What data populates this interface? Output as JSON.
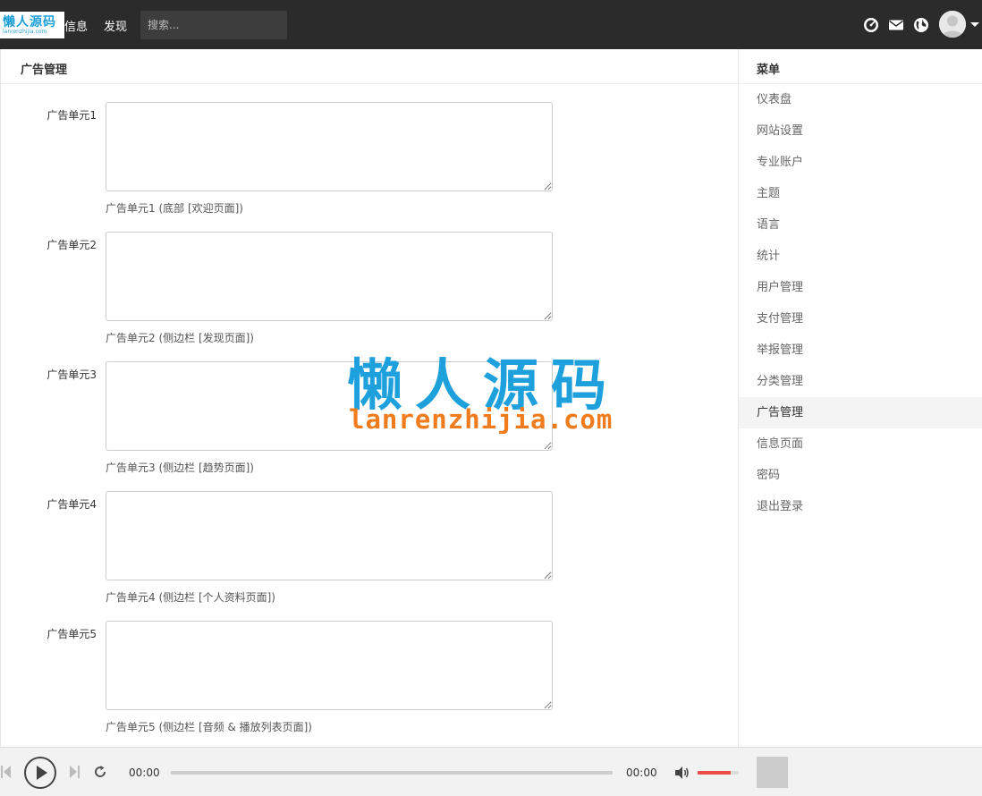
{
  "brand": {
    "logo_cn": "懒人源码",
    "logo_en": "lanrenzhijia.com"
  },
  "topnav": {
    "messages": "信息",
    "discover": "发现",
    "search_placeholder": "搜索..."
  },
  "panel": {
    "title": "广告管理",
    "fields": [
      {
        "label": "广告单元1",
        "help": "广告单元1 (底部 [欢迎页面])",
        "value": ""
      },
      {
        "label": "广告单元2",
        "help": "广告单元2 (侧边栏 [发现页面])",
        "value": ""
      },
      {
        "label": "广告单元3",
        "help": "广告单元3 (侧边栏 [趋势页面])",
        "value": ""
      },
      {
        "label": "广告单元4",
        "help": "广告单元4 (侧边栏 [个人资料页面])",
        "value": ""
      },
      {
        "label": "广告单元5",
        "help": "广告单元5 (侧边栏 [音频 & 播放列表页面])",
        "value": ""
      }
    ]
  },
  "sidebar": {
    "title": "菜单",
    "items": [
      {
        "label": "仪表盘"
      },
      {
        "label": "网站设置"
      },
      {
        "label": "专业账户"
      },
      {
        "label": "主题"
      },
      {
        "label": "语言"
      },
      {
        "label": "统计"
      },
      {
        "label": "用户管理"
      },
      {
        "label": "支付管理"
      },
      {
        "label": "举报管理"
      },
      {
        "label": "分类管理"
      },
      {
        "label": "广告管理",
        "active": true
      },
      {
        "label": "信息页面"
      },
      {
        "label": "密码"
      },
      {
        "label": "退出登录"
      }
    ]
  },
  "watermark": {
    "cn": "懒人源码",
    "en": "lanrenzhijia.com"
  },
  "player": {
    "current_time": "00:00",
    "total_time": "00:00",
    "progress": 0,
    "volume": 0.8
  },
  "colors": {
    "topbar": "#2b2b2b",
    "accent_blue": "#1ea0dc",
    "accent_orange": "#f07c1e",
    "volume": "#e94b4b"
  },
  "icons": [
    "dashboard-icon",
    "mail-icon",
    "globe-icon",
    "avatar-icon",
    "prev-icon",
    "play-icon",
    "next-icon",
    "repeat-icon",
    "volume-icon"
  ]
}
